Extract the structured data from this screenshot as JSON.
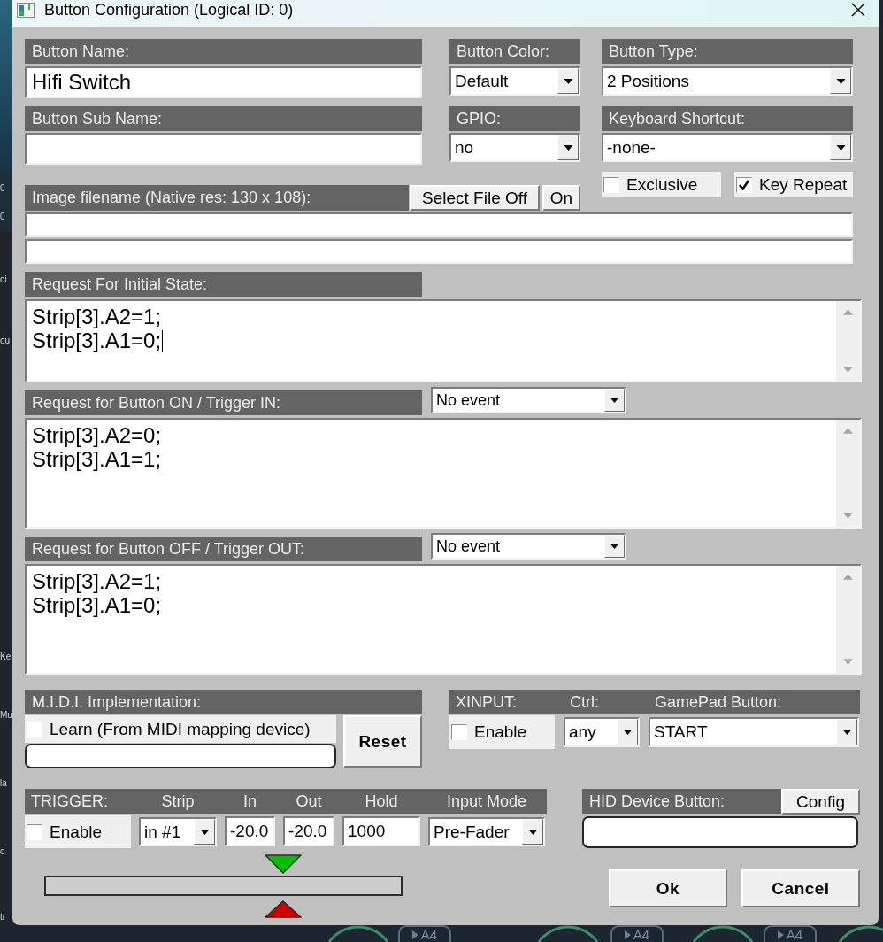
{
  "window": {
    "title": "Button Configuration (Logical ID: 0)"
  },
  "general": {
    "button_name": {
      "label": "Button Name:",
      "value": "Hifi Switch"
    },
    "button_sub_name": {
      "label": "Button Sub Name:"
    },
    "button_color": {
      "label": "Button Color:",
      "value": "Default"
    },
    "button_type": {
      "label": "Button Type:",
      "value": "2 Positions"
    },
    "gpio": {
      "label": "GPIO:",
      "value": "no"
    },
    "keyboard_shortcut": {
      "label": "Keyboard Shortcut:",
      "value": "-none-"
    },
    "options": [
      {
        "label": "Exclusive",
        "checked": false
      },
      {
        "label": "Key Repeat",
        "checked": true
      }
    ]
  },
  "image": {
    "label": "Image filename (Native res: 130 x 108):",
    "select_file_button": "Select File Off",
    "on_button": "On"
  },
  "requests": [
    {
      "label": "Request For Initial State:",
      "value": "Strip[3].A2=1;\nStrip[3].A1=0;",
      "focused": true
    },
    {
      "label": "Request for Button ON / Trigger IN:",
      "event": "No event",
      "value": "Strip[3].A2=0;\nStrip[3].A1=1;",
      "focused": false
    },
    {
      "label": "Request for Button OFF / Trigger OUT:",
      "event": "No event",
      "value": "Strip[3].A2=1;\nStrip[3].A1=0;",
      "focused": false
    }
  ],
  "midi": {
    "label": "M.I.D.I. Implementation:",
    "learn": {
      "label": "Learn (From MIDI mapping device)",
      "checked": false
    },
    "reset_button": "Reset"
  },
  "xinput": {
    "columns": [
      "XINPUT:",
      "Ctrl:",
      "GamePad Button:"
    ],
    "fields": [
      {
        "kind": "checkbox",
        "label": "Enable",
        "checked": false
      },
      {
        "kind": "select",
        "value": "any"
      },
      {
        "kind": "select",
        "value": "START"
      }
    ]
  },
  "trigger": {
    "columns": [
      "TRIGGER:",
      "Strip",
      "In",
      "Out",
      "Hold",
      "Input Mode"
    ],
    "fields": [
      {
        "kind": "checkbox",
        "label": "Enable",
        "checked": false
      },
      {
        "kind": "select",
        "value": "in #1"
      },
      {
        "kind": "input",
        "value": "-20.0"
      },
      {
        "kind": "input",
        "value": "-20.0"
      },
      {
        "kind": "input",
        "value": "1000"
      },
      {
        "kind": "select",
        "value": "Pre-Fader"
      }
    ]
  },
  "hid": {
    "label": "HID Device Button:",
    "config_button": "Config"
  },
  "buttons": [
    "Ok",
    "Cancel"
  ],
  "background_app": {
    "side_texts": [
      "0",
      "0",
      "di",
      "ou",
      "Ke",
      "Mu",
      "la",
      "o",
      "tr"
    ],
    "badges": [
      "A4",
      "A4",
      "A4"
    ]
  }
}
